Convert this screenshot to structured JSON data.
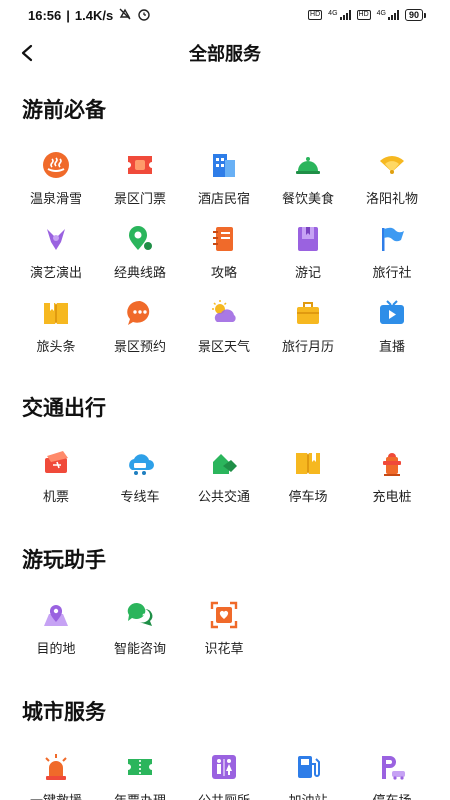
{
  "status": {
    "time": "16:56",
    "speed": "1.4K/s",
    "battery": "90"
  },
  "nav": {
    "title": "全部服务"
  },
  "sections": [
    {
      "title": "游前必备",
      "items": [
        {
          "label": "温泉滑雪",
          "icon": "hot-spring-icon"
        },
        {
          "label": "景区门票",
          "icon": "ticket-icon"
        },
        {
          "label": "酒店民宿",
          "icon": "hotel-icon"
        },
        {
          "label": "餐饮美食",
          "icon": "food-cloche-icon"
        },
        {
          "label": "洛阳礼物",
          "icon": "gift-fan-icon"
        },
        {
          "label": "演艺演出",
          "icon": "performance-icon"
        },
        {
          "label": "经典线路",
          "icon": "route-pin-icon"
        },
        {
          "label": "攻略",
          "icon": "notebook-icon"
        },
        {
          "label": "游记",
          "icon": "travel-note-icon"
        },
        {
          "label": "旅行社",
          "icon": "flag-icon"
        },
        {
          "label": "旅头条",
          "icon": "headline-book-icon"
        },
        {
          "label": "景区预约",
          "icon": "chat-bubble-icon"
        },
        {
          "label": "景区天气",
          "icon": "weather-icon"
        },
        {
          "label": "旅行月历",
          "icon": "calendar-bag-icon"
        },
        {
          "label": "直播",
          "icon": "live-tv-icon"
        }
      ]
    },
    {
      "title": "交通出行",
      "items": [
        {
          "label": "机票",
          "icon": "airplane-ticket-icon"
        },
        {
          "label": "专线车",
          "icon": "shuttle-cloud-icon"
        },
        {
          "label": "公共交通",
          "icon": "public-transport-icon"
        },
        {
          "label": "停车场",
          "icon": "parking-icon"
        },
        {
          "label": "充电桩",
          "icon": "charging-pile-icon"
        }
      ]
    },
    {
      "title": "游玩助手",
      "items": [
        {
          "label": "目的地",
          "icon": "destination-icon"
        },
        {
          "label": "智能咨询",
          "icon": "smart-consult-icon"
        },
        {
          "label": "识花草",
          "icon": "flower-scan-icon"
        }
      ]
    },
    {
      "title": "城市服务",
      "items": [
        {
          "label": "一键救援",
          "icon": "alarm-light-icon"
        },
        {
          "label": "年票办理",
          "icon": "annual-ticket-icon"
        },
        {
          "label": "公共厕所",
          "icon": "restroom-icon"
        },
        {
          "label": "加油站",
          "icon": "gas-station-icon"
        },
        {
          "label": "停车场",
          "icon": "parking-car-icon"
        }
      ]
    }
  ]
}
